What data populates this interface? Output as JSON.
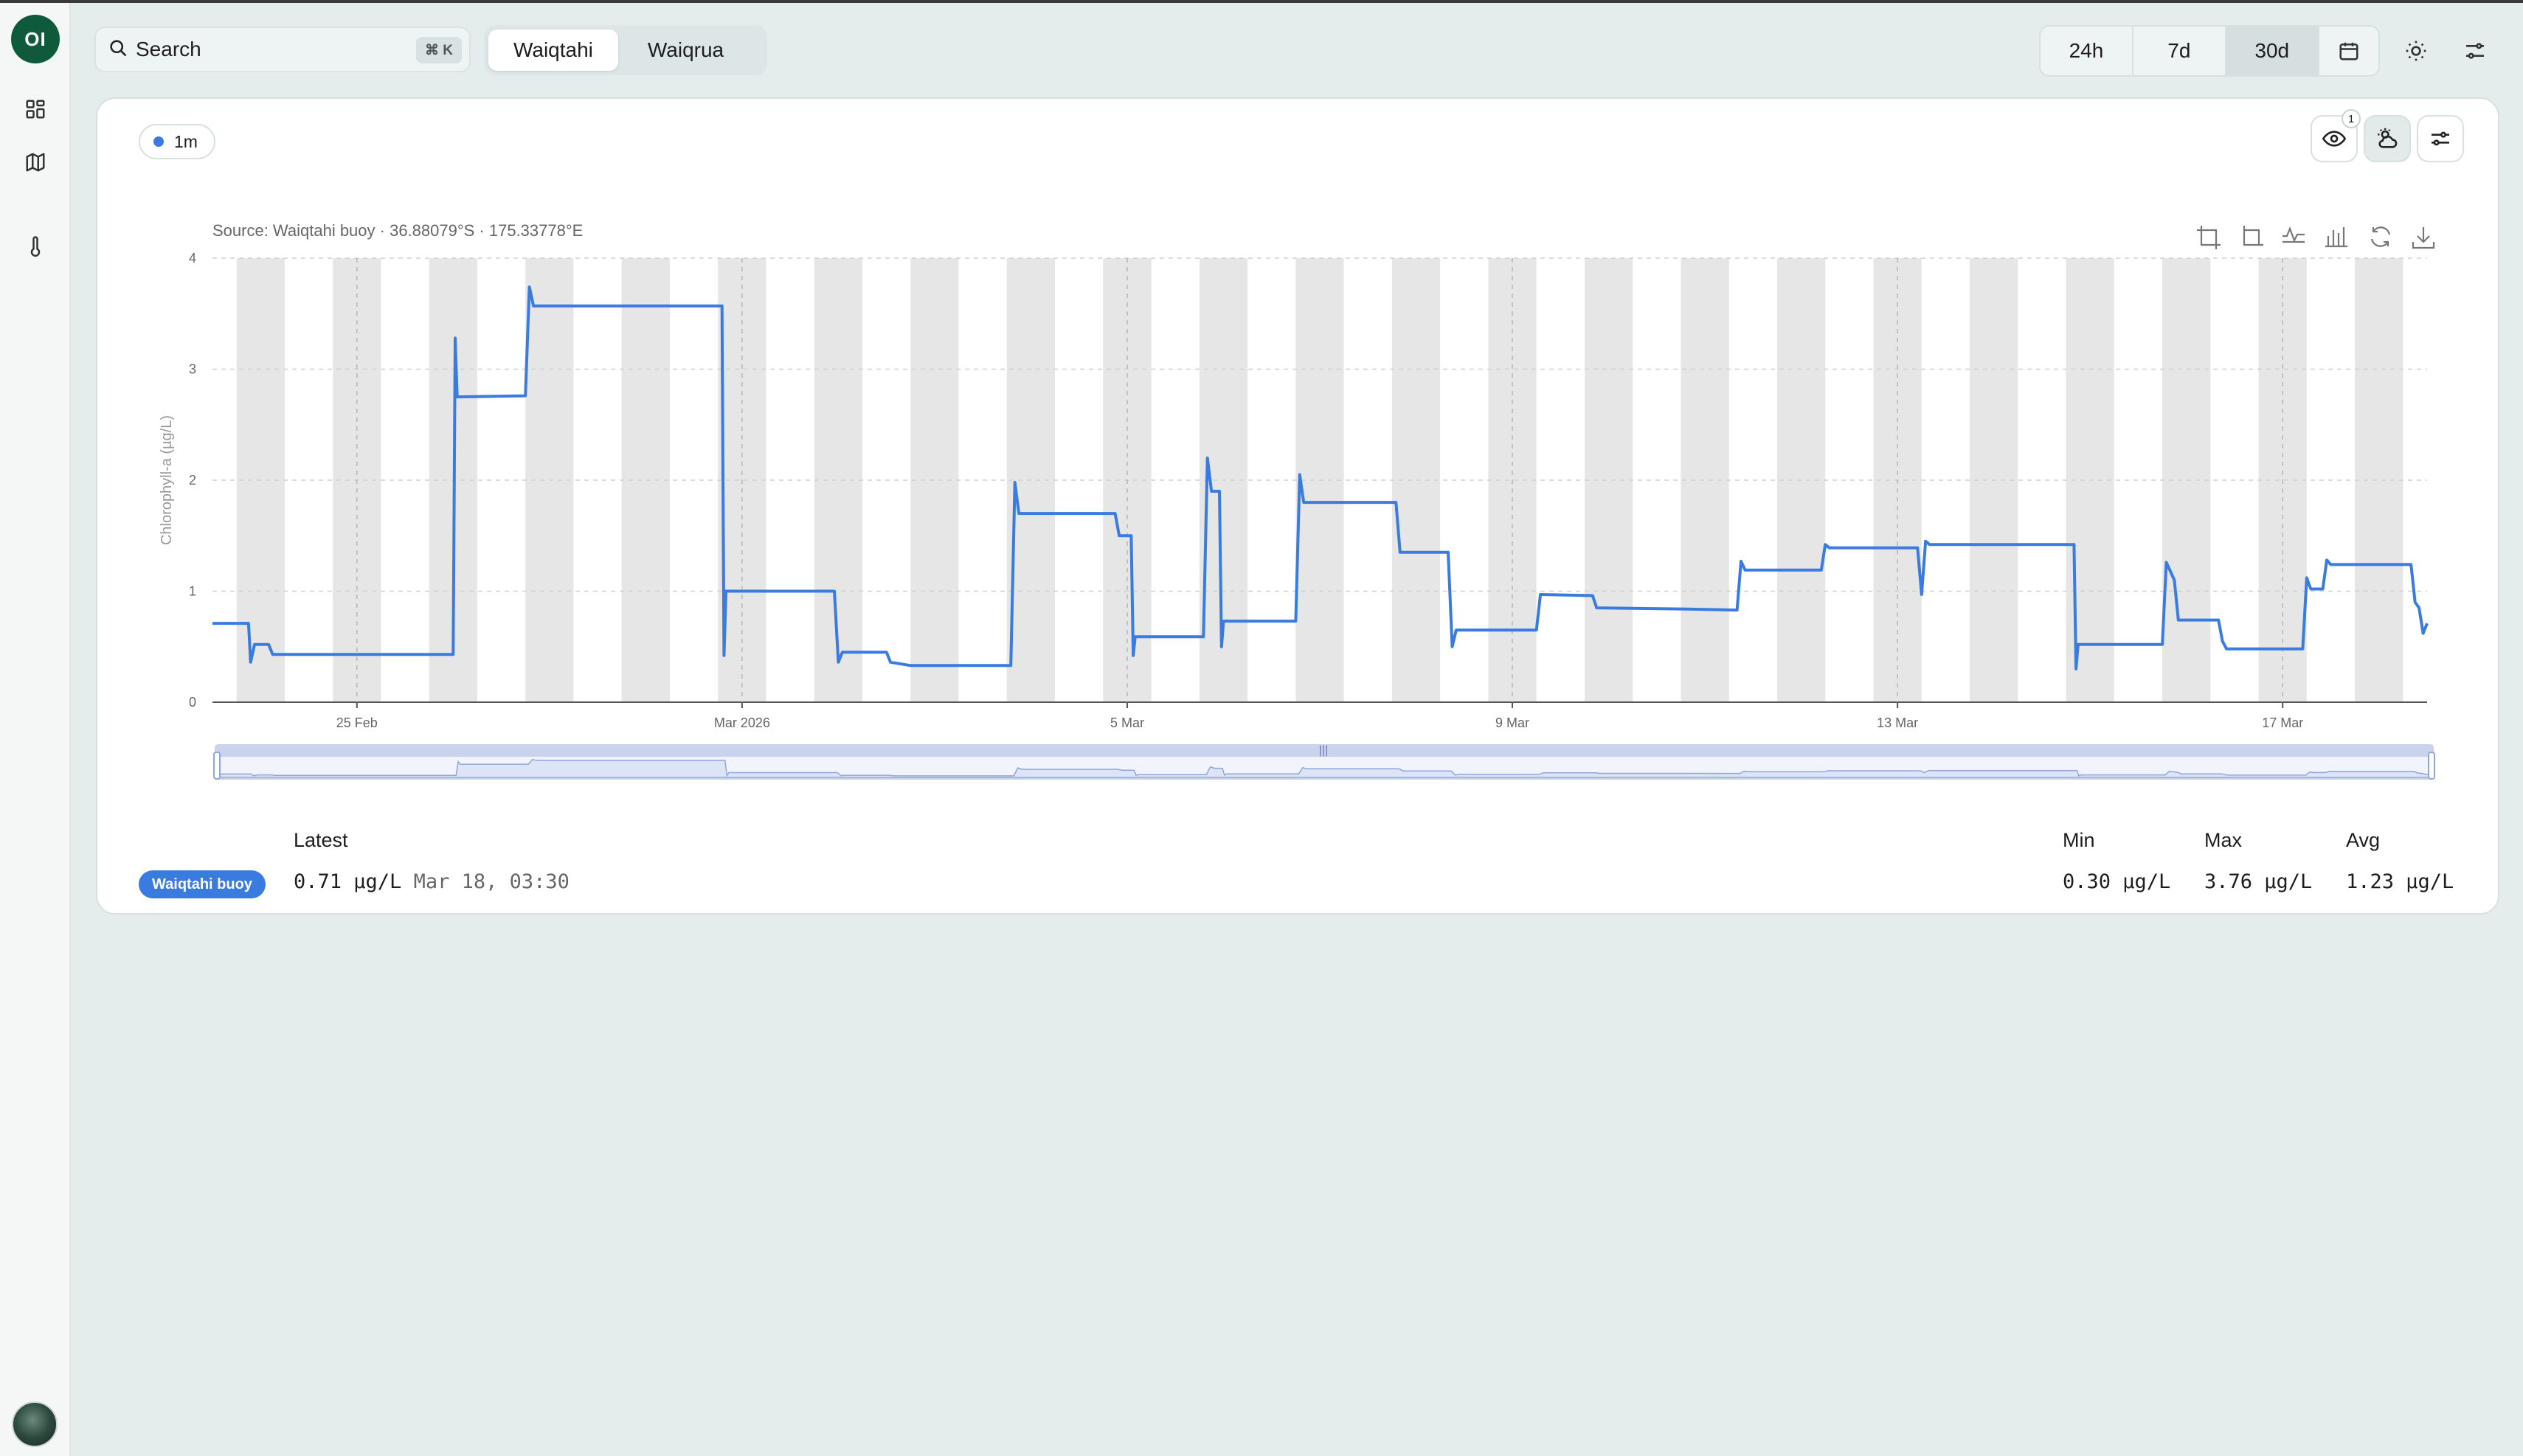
{
  "app": {
    "logo_text": "OI"
  },
  "sidebar": {
    "items": [
      {
        "name": "dashboard",
        "icon": "grid-icon"
      },
      {
        "name": "map",
        "icon": "map-icon"
      },
      {
        "name": "temperature",
        "icon": "thermometer-icon"
      }
    ]
  },
  "search": {
    "label": "Search",
    "shortcut": "⌘ K"
  },
  "locations": {
    "tabs": [
      "Waiqtahi",
      "Waiqrua"
    ],
    "active": "Waiqtahi"
  },
  "time_range": {
    "options": [
      "24h",
      "7d",
      "30d"
    ],
    "active": "30d"
  },
  "card": {
    "resolution_chip": "1m",
    "visibility_badge": "1",
    "source": "Source: Waiqtahi buoy · 36.88079°S · 175.33778°E"
  },
  "colors": {
    "series": "#3a7be0",
    "night_band": "#e6e6e6",
    "brand": "#0f5a3a"
  },
  "chart_data": {
    "type": "line",
    "ylabel": "Chlorophyll-a (µg/L)",
    "xlabel": "",
    "ylim": [
      0,
      4
    ],
    "yticks": [
      "0",
      "1",
      "2",
      "3",
      "4"
    ],
    "x_range": [
      "2026-02-23T12:00",
      "2026-03-18T12:00"
    ],
    "xticks": [
      {
        "date": "2026-02-25",
        "label": "25 Feb"
      },
      {
        "date": "2026-03-01",
        "label": "Mar 2026"
      },
      {
        "date": "2026-03-05",
        "label": "5 Mar"
      },
      {
        "date": "2026-03-09",
        "label": "9 Mar"
      },
      {
        "date": "2026-03-13",
        "label": "13 Mar"
      },
      {
        "date": "2026-03-17",
        "label": "17 Mar"
      }
    ],
    "night_bands": true,
    "grid": true,
    "series": [
      {
        "name": "Waiqtahi buoy",
        "points": [
          [
            "2026-02-23T12:00",
            0.71
          ],
          [
            "2026-02-23T21:00",
            0.71
          ],
          [
            "2026-02-23T21:30",
            0.36
          ],
          [
            "2026-02-23T22:30",
            0.52
          ],
          [
            "2026-02-24T02:00",
            0.52
          ],
          [
            "2026-02-24T03:00",
            0.43
          ],
          [
            "2026-02-26T00:00",
            0.43
          ],
          [
            "2026-02-26T00:30",
            3.28
          ],
          [
            "2026-02-26T01:00",
            2.75
          ],
          [
            "2026-02-26T18:00",
            2.76
          ],
          [
            "2026-02-26T19:00",
            3.74
          ],
          [
            "2026-02-26T20:00",
            3.57
          ],
          [
            "2026-02-28T19:00",
            3.57
          ],
          [
            "2026-02-28T19:30",
            0.42
          ],
          [
            "2026-02-28T20:00",
            1.0
          ],
          [
            "2026-03-01T23:00",
            1.0
          ],
          [
            "2026-03-02T00:00",
            0.36
          ],
          [
            "2026-03-02T01:00",
            0.45
          ],
          [
            "2026-03-02T12:00",
            0.45
          ],
          [
            "2026-03-02T13:00",
            0.36
          ],
          [
            "2026-03-02T18:00",
            0.33
          ],
          [
            "2026-03-03T19:00",
            0.33
          ],
          [
            "2026-03-03T20:00",
            1.98
          ],
          [
            "2026-03-03T21:00",
            1.7
          ],
          [
            "2026-03-04T21:00",
            1.7
          ],
          [
            "2026-03-04T22:00",
            1.5
          ],
          [
            "2026-03-05T01:00",
            1.5
          ],
          [
            "2026-03-05T01:30",
            0.42
          ],
          [
            "2026-03-05T02:00",
            0.59
          ],
          [
            "2026-03-05T19:00",
            0.59
          ],
          [
            "2026-03-05T20:00",
            2.2
          ],
          [
            "2026-03-05T21:00",
            1.9
          ],
          [
            "2026-03-05T23:00",
            1.9
          ],
          [
            "2026-03-05T23:30",
            0.5
          ],
          [
            "2026-03-06T00:00",
            0.73
          ],
          [
            "2026-03-06T18:00",
            0.73
          ],
          [
            "2026-03-06T19:00",
            2.05
          ],
          [
            "2026-03-06T20:00",
            1.8
          ],
          [
            "2026-03-07T19:00",
            1.8
          ],
          [
            "2026-03-07T20:00",
            1.35
          ],
          [
            "2026-03-08T08:00",
            1.35
          ],
          [
            "2026-03-08T09:00",
            0.5
          ],
          [
            "2026-03-08T10:00",
            0.65
          ],
          [
            "2026-03-09T06:00",
            0.65
          ],
          [
            "2026-03-09T07:00",
            0.97
          ],
          [
            "2026-03-09T20:00",
            0.96
          ],
          [
            "2026-03-09T21:00",
            0.85
          ],
          [
            "2026-03-10T18:00",
            0.84
          ],
          [
            "2026-03-11T08:00",
            0.83
          ],
          [
            "2026-03-11T09:00",
            1.27
          ],
          [
            "2026-03-11T10:00",
            1.19
          ],
          [
            "2026-03-12T05:00",
            1.19
          ],
          [
            "2026-03-12T06:00",
            1.42
          ],
          [
            "2026-03-12T07:00",
            1.39
          ],
          [
            "2026-03-13T05:00",
            1.39
          ],
          [
            "2026-03-13T06:00",
            0.97
          ],
          [
            "2026-03-13T07:00",
            1.45
          ],
          [
            "2026-03-13T08:00",
            1.42
          ],
          [
            "2026-03-14T20:00",
            1.42
          ],
          [
            "2026-03-14T20:30",
            0.3
          ],
          [
            "2026-03-14T21:00",
            0.52
          ],
          [
            "2026-03-15T18:00",
            0.52
          ],
          [
            "2026-03-15T19:00",
            1.26
          ],
          [
            "2026-03-15T21:00",
            1.1
          ],
          [
            "2026-03-15T22:00",
            0.74
          ],
          [
            "2026-03-16T08:00",
            0.74
          ],
          [
            "2026-03-16T09:00",
            0.55
          ],
          [
            "2026-03-16T10:00",
            0.48
          ],
          [
            "2026-03-17T05:00",
            0.48
          ],
          [
            "2026-03-17T06:00",
            1.12
          ],
          [
            "2026-03-17T07:00",
            1.02
          ],
          [
            "2026-03-17T10:00",
            1.02
          ],
          [
            "2026-03-17T11:00",
            1.28
          ],
          [
            "2026-03-17T12:00",
            1.24
          ],
          [
            "2026-03-18T08:00",
            1.24
          ],
          [
            "2026-03-18T09:00",
            0.9
          ],
          [
            "2026-03-18T10:00",
            0.85
          ],
          [
            "2026-03-18T11:00",
            0.62
          ],
          [
            "2026-03-18T12:00",
            0.71
          ]
        ]
      }
    ]
  },
  "stats": {
    "series_label": "Waiqtahi buoy",
    "latest_label": "Latest",
    "latest_value": "0.71 µg/L",
    "latest_time": "Mar 18, 03:30",
    "min_label": "Min",
    "min_value": "0.30 µg/L",
    "max_label": "Max",
    "max_value": "3.76 µg/L",
    "avg_label": "Avg",
    "avg_value": "1.23 µg/L"
  }
}
